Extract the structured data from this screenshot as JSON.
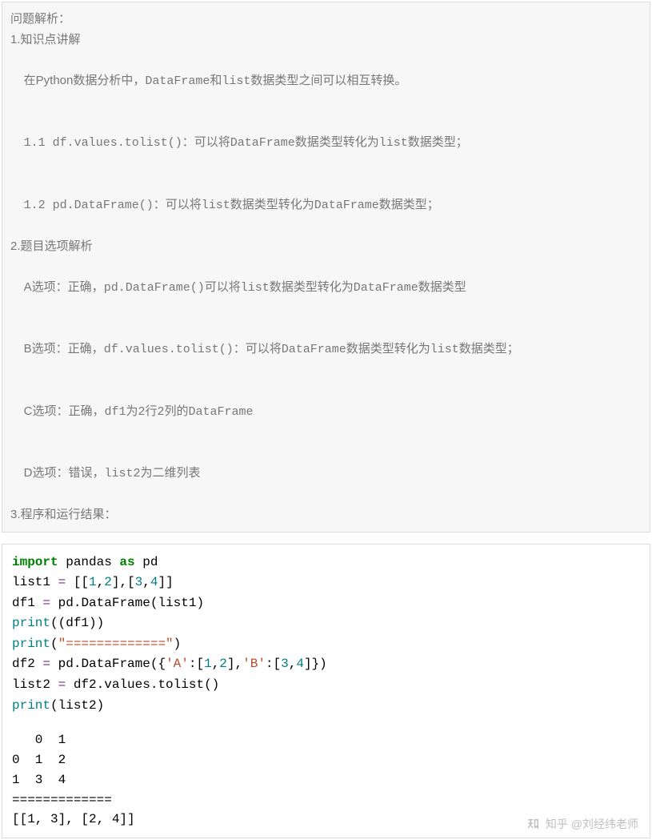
{
  "analysis": {
    "title": "问题解析：",
    "l1": "1.知识点讲解",
    "l2_pre": "在Python数据分析中，",
    "l2_mid": "DataFrame和list",
    "l2_post": "数据类型之间可以相互转换。",
    "l3_a": "1.1 df.values.tolist()：",
    "l3_b": "可以将DataFrame数据类型转化为list数据类型；",
    "l4_a": "1.2 pd.DataFrame()：",
    "l4_b": "可以将list数据类型转化为DataFrame数据类型；",
    "l5": "2.题目选项解析",
    "lA_a": "A选项：正确，",
    "lA_b": "pd.DataFrame()可以将list数据类型转化为DataFrame",
    "lA_c": "数据类型",
    "lB_a": "B选项：正确，",
    "lB_b": "df.values.tolist()：",
    "lB_c": "可以将DataFrame数据类型转化为list数据类型；",
    "lC_a": "C选项：正确，",
    "lC_b": "df1为2行2列的DataFrame",
    "lD_a": "D选项：错误，",
    "lD_b": "list2为二维列表",
    "l6": "3.程序和运行结果："
  },
  "code": {
    "kw_import": "import",
    "kw_as": "as",
    "pandas": " pandas ",
    "pd": " pd",
    "l2_a": "list1 ",
    "l2_eq": "=",
    "l2_b": " [[",
    "n1": "1",
    "comma": ",",
    "n2": "2",
    "n3": "3",
    "n4": "4",
    "l2_c": "],[",
    "l2_d": "]]",
    "l3_a": "df1 ",
    "l3_b": " pd",
    "dot": ".",
    "DataFrame": "DataFrame",
    "l3_c": "(list1)",
    "print": "print",
    "l4_a": "((df1))",
    "l5_a": "(",
    "str_sep": "\"=============\"",
    "l5_b": ")",
    "l6_a": "df2 ",
    "l6_b": " pd",
    "l6_c": "({",
    "strA": "'A'",
    "l6_d": ":[",
    "l6_e": "],",
    "strB": "'B'",
    "l6_f": "]})",
    "l7_a": "list2 ",
    "l7_b": " df2",
    "values": "values",
    "tolist": "tolist",
    "l7_c": "()",
    "l8_a": "(list2)"
  },
  "output": "   0  1\n0  1  2\n1  3  4\n=============\n[[1, 3], [2, 4]]",
  "watermark": "知乎 @刘经纬老师"
}
